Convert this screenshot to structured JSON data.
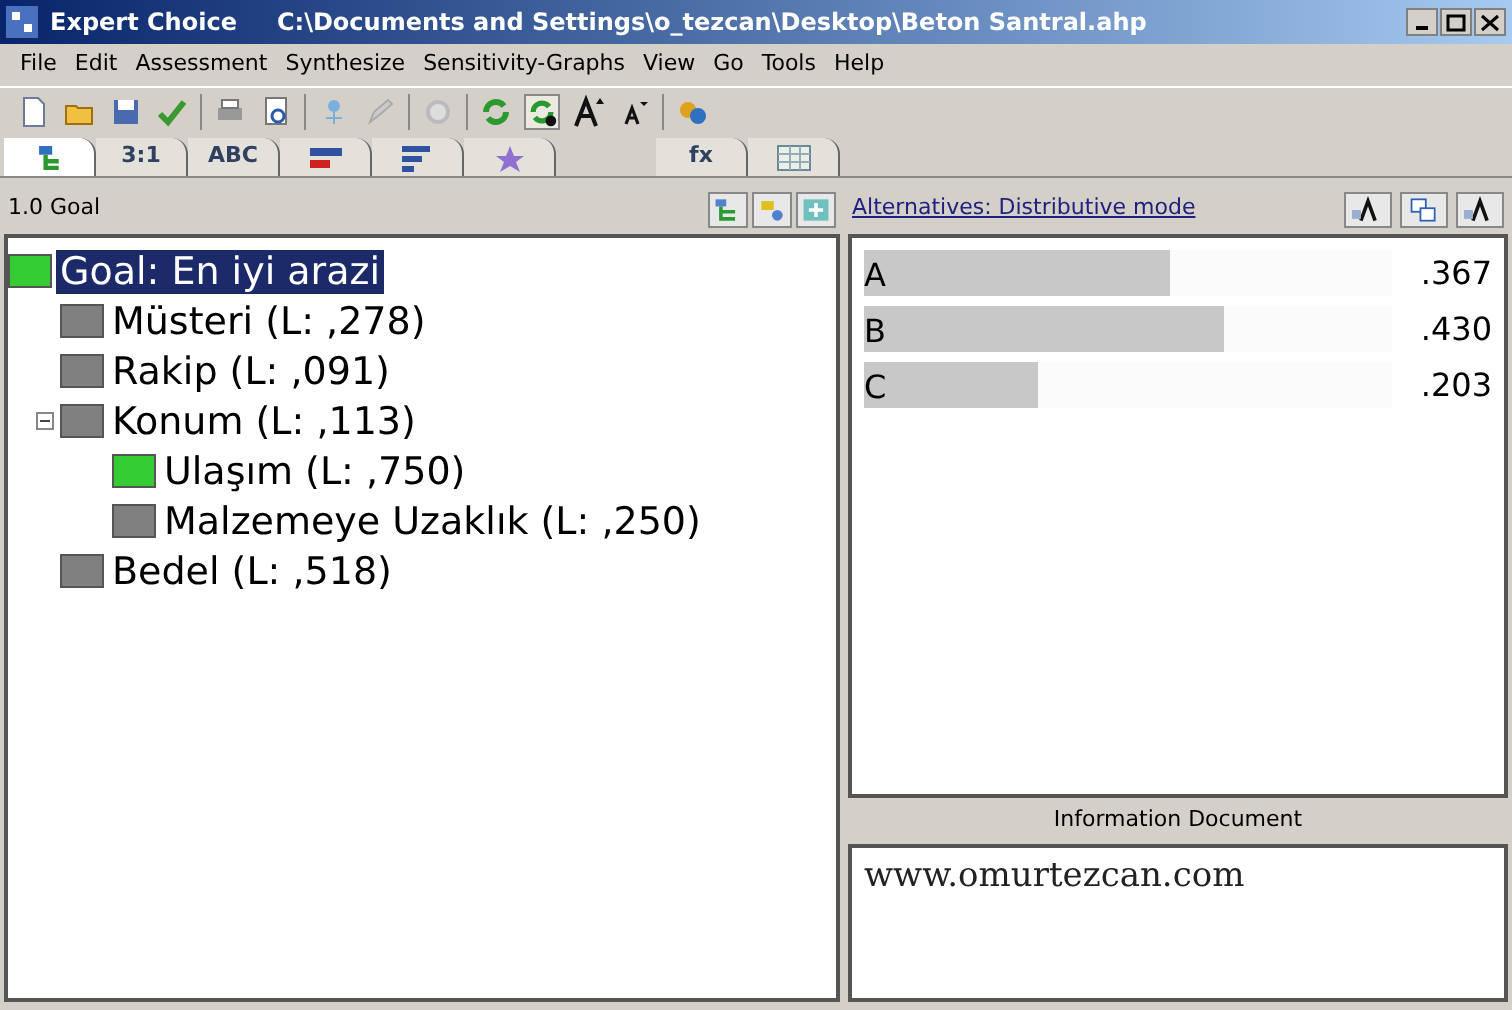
{
  "window": {
    "app": "Expert Choice",
    "path": "C:\\Documents and Settings\\o_tezcan\\Desktop\\Beton Santral.ahp"
  },
  "menu": [
    "File",
    "Edit",
    "Assessment",
    "Synthesize",
    "Sensitivity-Graphs",
    "View",
    "Go",
    "Tools",
    "Help"
  ],
  "tabs": [
    {
      "kind": "tree",
      "selected": true
    },
    {
      "kind": "text",
      "label": "3:1",
      "selected": false
    },
    {
      "kind": "text",
      "label": "ABC",
      "selected": false
    },
    {
      "kind": "bars",
      "selected": false
    },
    {
      "kind": "lines",
      "selected": false
    },
    {
      "kind": "star",
      "selected": false
    },
    {
      "kind": "spacer"
    },
    {
      "kind": "text",
      "label": "fx",
      "selected": false
    },
    {
      "kind": "grid",
      "selected": false
    }
  ],
  "left_panel": {
    "header": "1.0 Goal",
    "tree": [
      {
        "label": "Goal: En iyi arazi",
        "color": "#33cc33",
        "selected": true,
        "children": [
          {
            "label": "Müsteri (L: ,278)",
            "color": "#808080",
            "selected": false
          },
          {
            "label": "Rakip (L: ,091)",
            "color": "#808080",
            "selected": false
          },
          {
            "label": "Konum (L: ,113)",
            "color": "#808080",
            "selected": false,
            "expanded": true,
            "children": [
              {
                "label": "Ulaşım (L: ,750)",
                "color": "#33cc33",
                "selected": false
              },
              {
                "label": "Malzemeye Uzaklık (L: ,250)",
                "color": "#808080",
                "selected": false
              }
            ]
          },
          {
            "label": "Bedel (L: ,518)",
            "color": "#808080",
            "selected": false
          }
        ]
      }
    ]
  },
  "right_panel": {
    "link": "Alternatives: Distributive mode",
    "alternatives": [
      {
        "name": "A",
        "value": ".367",
        "level": 0.58
      },
      {
        "name": "B",
        "value": ".430",
        "level": 0.68
      },
      {
        "name": "C",
        "value": ".203",
        "level": 0.33
      }
    ],
    "info_label": "Information Document",
    "info_text": "www.omurtezcan.com"
  }
}
